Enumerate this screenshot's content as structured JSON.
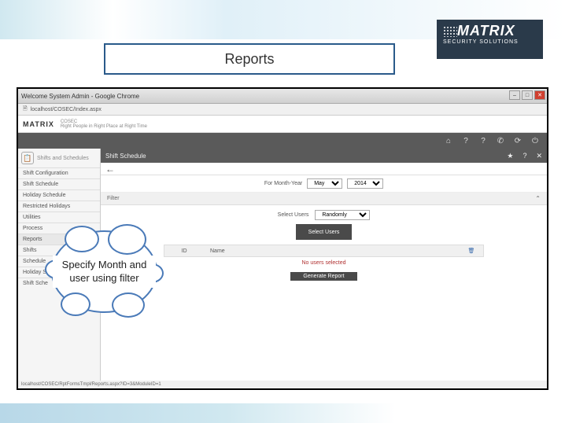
{
  "slide": {
    "title": "Reports",
    "callout": "Specify Month and user using filter"
  },
  "logo": {
    "brand": "MATRIX",
    "tagline": "SECURITY SOLUTIONS"
  },
  "chrome": {
    "title": "Welcome System Admin - Google Chrome",
    "address": "localhost/COSEC/Index.aspx",
    "status": "localhost/COSEC/RptFormsTmpl/Reports.aspx?ID=3&ModuleID=1"
  },
  "app": {
    "header_logo": "MATRIX",
    "header_product": "COSEC",
    "header_tagline": "Right People in Right Place at Right Time",
    "section_title": "Shift Schedule"
  },
  "sidebar": {
    "header": "Shifts and Schedules",
    "items": [
      "Shift Configuration",
      "Shift Schedule",
      "Holiday Schedule",
      "Restricted Holidays",
      "Utilities",
      "Process",
      "Reports",
      "Shifts",
      "Schedule",
      "Holiday Sc",
      "Shift Sche"
    ]
  },
  "filters": {
    "month_label": "For Month-Year",
    "month_value": "May",
    "year_value": "2014",
    "filter_label": "Filter",
    "select_users_label": "Select Users",
    "select_users_value": "Randomly",
    "select_users_button": "Select Users"
  },
  "table": {
    "col_id": "ID",
    "col_name": "Name",
    "empty_msg": "No users selected"
  },
  "actions": {
    "generate": "Generate Report"
  },
  "toolbar_icons": {
    "home": "⌂",
    "help1": "?",
    "help2": "?",
    "phone": "✆",
    "refresh": "⟳",
    "power": "⏻"
  },
  "content_icons": {
    "star": "★",
    "help": "?",
    "close": "✕"
  }
}
